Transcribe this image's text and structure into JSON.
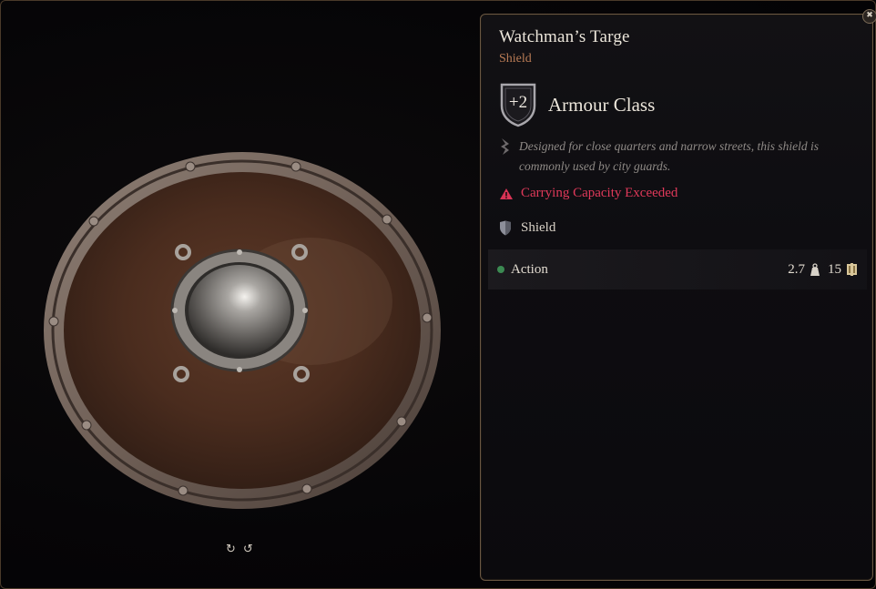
{
  "item": {
    "name": "Watchman’s Targe",
    "type_label": "Shield",
    "armour_class_value": "+2",
    "armour_class_label": "Armour Class",
    "description": "Designed for close quarters and narrow streets, this shield is commonly used by city guards.",
    "warning": "Carrying Capacity Exceeded",
    "category": "Shield",
    "action": "Action",
    "weight": "2.7",
    "value": "15"
  },
  "controls": {
    "rotate_left": "↻",
    "rotate_right": "↺",
    "close": "✖"
  },
  "icons": {
    "close": "close-icon",
    "ac_badge": "shield-badge-icon",
    "description": "quill-icon",
    "warning": "warning-triangle-icon",
    "category": "shield-icon",
    "action": "action-dot-icon",
    "weight": "weight-icon",
    "value": "gold-icon",
    "rotate_left": "rotate-left-icon",
    "rotate_right": "rotate-right-icon"
  },
  "colors": {
    "subtitle": "#b97b55",
    "warning": "#e0395a",
    "action_dot": "#3c8a52",
    "panel_border": "#6b5843"
  }
}
